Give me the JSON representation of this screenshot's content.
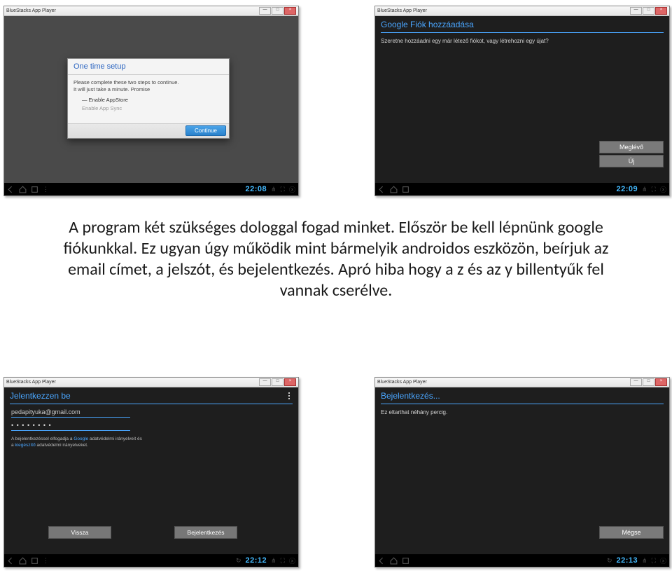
{
  "window": {
    "title": "BlueStacks App Player",
    "btn_min": "—",
    "btn_max": "□",
    "btn_close": "×"
  },
  "bars": {
    "t1": "22:08",
    "t2": "22:09",
    "t3": "22:12",
    "t4": "22:13"
  },
  "s1": {
    "dialog_title": "One time setup",
    "line1": "Please complete these two steps to continue.",
    "line2": "It will just take a minute. Promise",
    "item1": "Enable AppStore",
    "item2": "Enable App Sync",
    "continue": "Continue"
  },
  "s2": {
    "header": "Google Fiók hozzáadása",
    "question": "Szeretne hozzáadni egy már létező fiókot, vagy létrehozni egy újat?",
    "btn_exist": "Meglévő",
    "btn_new": "Új"
  },
  "s3": {
    "header": "Jelentkezzen be",
    "email": "pedapityuka@gmail.com",
    "pwd": "• • • • • • • •",
    "fine1": "A bejelentkezéssel elfogadja a ",
    "fine1b": "Google",
    "fine1c": " adatvédelmi irányelveit és",
    "fine2a": "a ",
    "fine2b": "kiegészítő",
    "fine2c": " adatvédelmi irányelveket.",
    "btn_back": "Vissza",
    "btn_login": "Bejelentkezés"
  },
  "s4": {
    "header": "Bejelentkezés...",
    "wait": "Ez eltarthat néhány percig.",
    "btn_cancel": "Mégse"
  },
  "text": {
    "p": "A program két szükséges dologgal fogad minket. Először be kell lépnünk google fiókunkkal. Ez ugyan úgy működik mint bármelyik androidos eszközön, beírjuk az email címet, a jelszót, és bejelentkezés. Apró hiba hogy a z és az y billentyűk fel vannak cserélve."
  }
}
